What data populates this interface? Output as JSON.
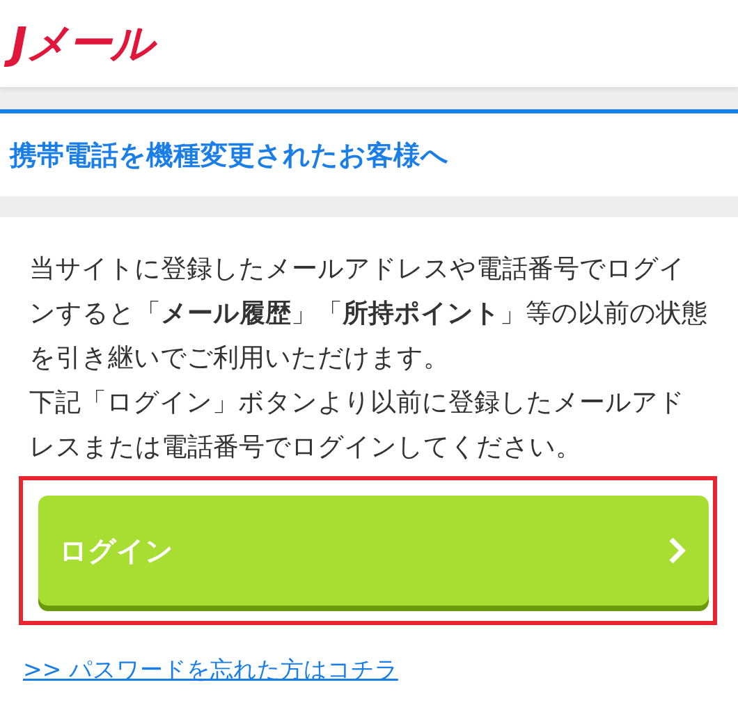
{
  "header": {
    "logo": "Jメール"
  },
  "notice": {
    "title": "携帯電話を機種変更されたお客様へ",
    "paragraphs": [
      "当サイトに登録したメールアドレスや電話番号でログインすると「**メール履歴**」「**所持ポイント**」等の以前の状態を引き継いでご利用いただけます。",
      "下記「ログイン」ボタンより以前に登録したメールアドレスまたは電話番号でログインしてください。"
    ],
    "login_button": {
      "label": "ログイン",
      "highlighted": true
    },
    "forgot_link": ">> パスワードを忘れた方はコチラ"
  }
}
